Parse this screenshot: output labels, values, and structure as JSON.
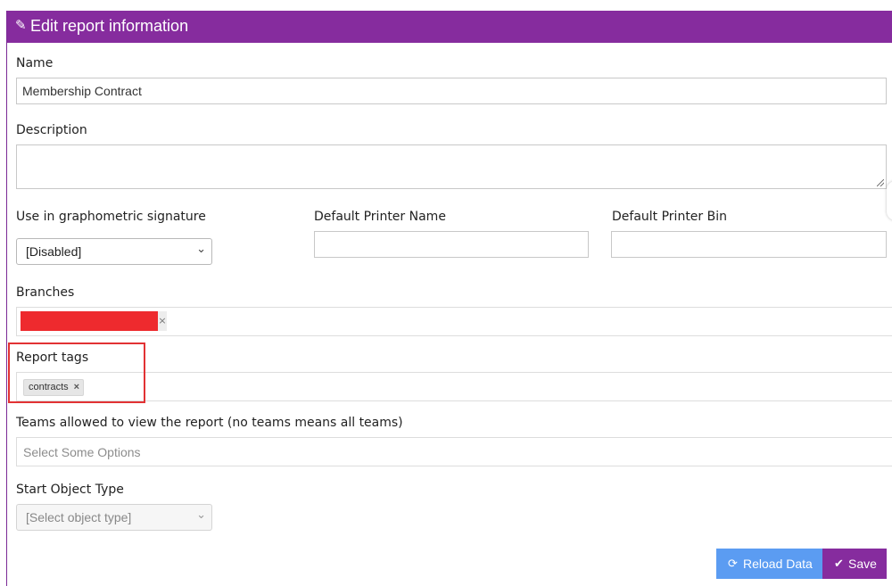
{
  "header": {
    "icon": "pencil-icon",
    "title": "Edit report information"
  },
  "form": {
    "name": {
      "label": "Name",
      "value": "Membership Contract"
    },
    "description": {
      "label": "Description",
      "value": ""
    },
    "graphometric": {
      "label": "Use in graphometric signature",
      "selected": "[Disabled]"
    },
    "printer_name": {
      "label": "Default Printer Name",
      "value": ""
    },
    "printer_bin": {
      "label": "Default Printer Bin",
      "value": ""
    },
    "branches": {
      "label": "Branches",
      "chip_remove": "×"
    },
    "report_tags": {
      "label": "Report tags",
      "tags": [
        "contracts"
      ],
      "remove": "×"
    },
    "teams": {
      "label": "Teams allowed to view the report (no teams means all teams)",
      "placeholder": "Select Some Options"
    },
    "start_object_type": {
      "label": "Start Object Type",
      "selected": "[Select object type]"
    }
  },
  "actions": {
    "reload": {
      "icon": "refresh-icon",
      "label": "Reload Data"
    },
    "save": {
      "icon": "check-circle-icon",
      "label": "Save"
    }
  },
  "colors": {
    "accent": "#862c9e",
    "reload": "#5b9cf2",
    "highlight": "#e23234",
    "redaction": "#ee2a2e"
  }
}
